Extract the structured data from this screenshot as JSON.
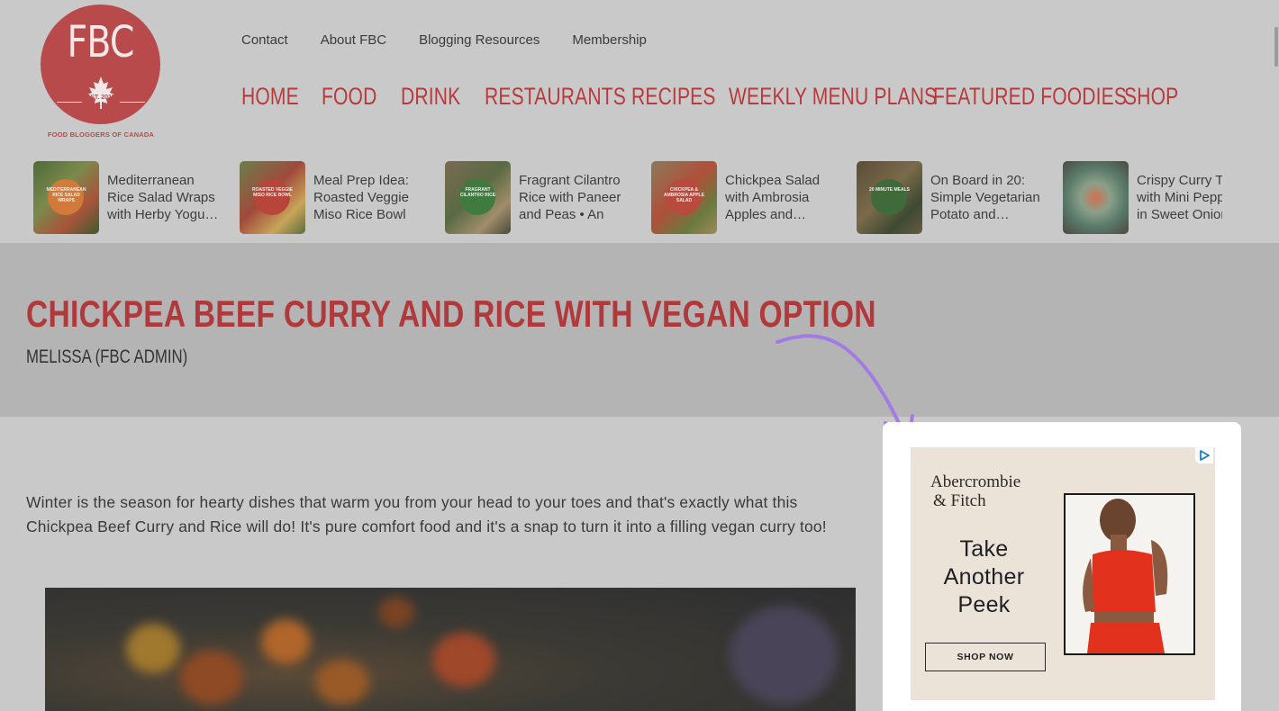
{
  "logo": {
    "text": "FBC",
    "est": "EST. 2011",
    "caption": "FOOD BLOGGERS OF CANADA"
  },
  "top_nav": [
    "Contact",
    "About FBC",
    "Blogging Resources",
    "Membership"
  ],
  "main_nav": [
    "HOME",
    "FOOD",
    "DRINK",
    "RESTAURANTS",
    "RECIPES",
    "WEEKLY MENU PLANS",
    "FEATURED FOODIES",
    "SHOP"
  ],
  "carousel": [
    {
      "title": "Mediterranean Rice Salad Wraps with Herby Yogu…",
      "thumb_text": "MEDITERRANEAN RICE SALAD WRAPS"
    },
    {
      "title": "Meal Prep Idea: Roasted Veggie Miso Rice Bowl",
      "thumb_text": "ROASTED VEGGIE MISO RICE BOWL"
    },
    {
      "title": "Fragrant Cilantro Rice with Paneer and Peas • An Ea…",
      "thumb_text": "FRAGRANT CILANTRO RICE"
    },
    {
      "title": "Chickpea Salad with Ambrosia Apples and…",
      "thumb_text": "CHICKPEA & AMBROSIA APPLE SALAD"
    },
    {
      "title": "On Board in 20: Simple Vegetarian Potato and…",
      "thumb_text": "20 MINUTE MEALS"
    },
    {
      "title": "Crispy Curry Tofu with Mini Peppers in Sweet Onion…",
      "thumb_text": ""
    }
  ],
  "post": {
    "title": "CHICKPEA BEEF CURRY AND RICE WITH VEGAN OPTION",
    "author": "MELISSA (FBC ADMIN)",
    "intro": "Winter is the season for hearty dishes that warm you from your head to your toes and that's exactly what this Chickpea Beef Curry and Rice will do! It's pure comfort food and it's a snap to turn it into a filling vegan curry too!"
  },
  "ad": {
    "brand_line1": "Abercrombie",
    "brand_line2": "& Fitch",
    "headline": [
      "Take",
      "Another",
      "Peek"
    ],
    "cta": "SHOP NOW"
  },
  "colors": {
    "brand_red": "#b83a3c",
    "annotation_arrow": "#a47ae6"
  }
}
